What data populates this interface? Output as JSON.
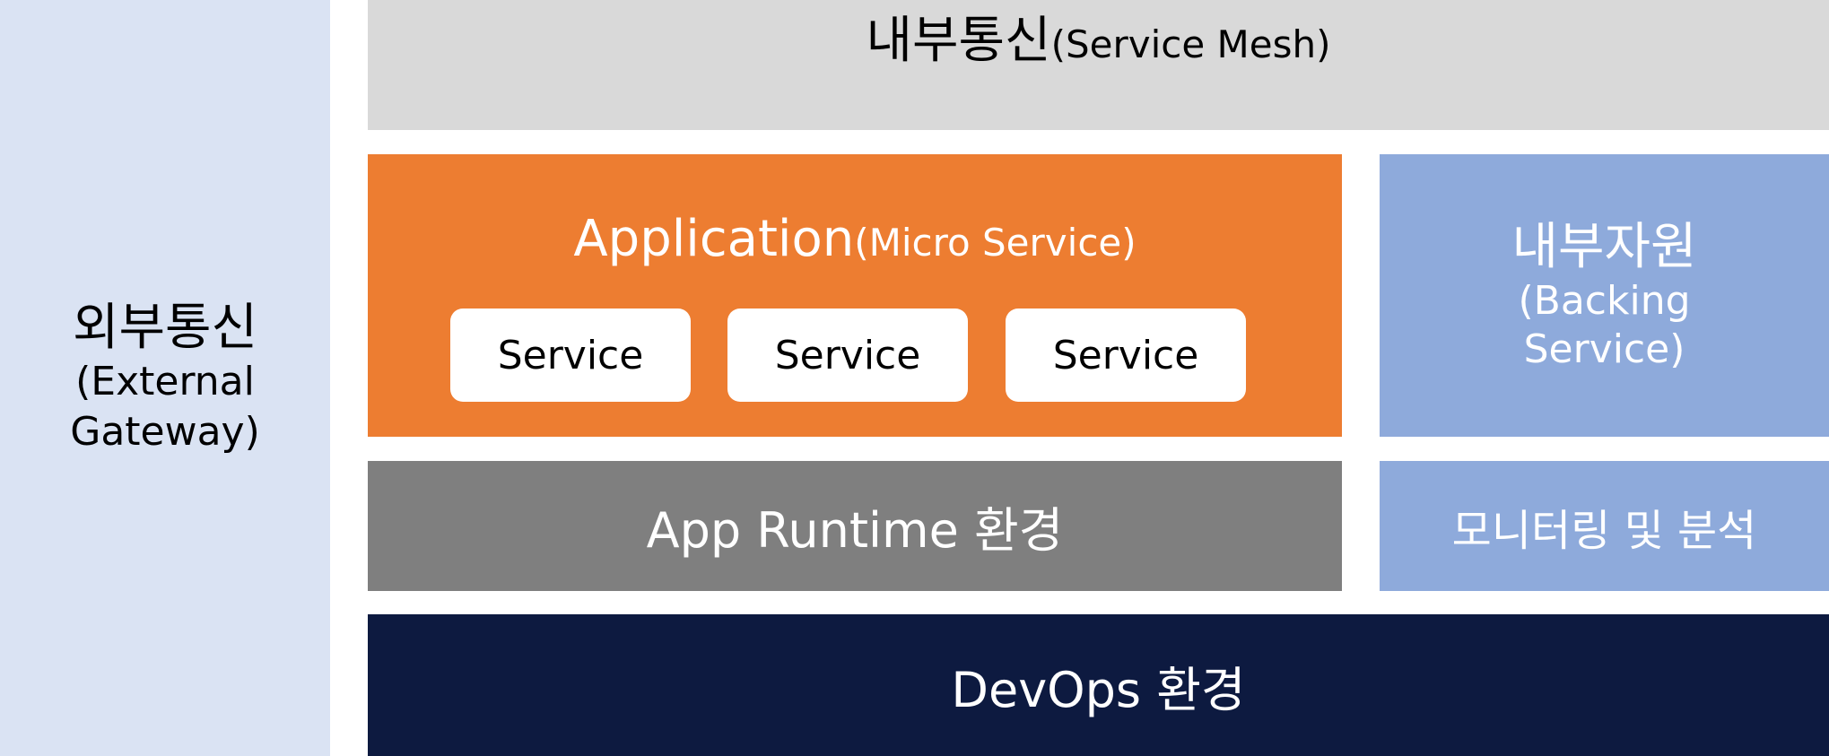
{
  "external_gateway": {
    "label": "외부통신",
    "sub_line1": "(External",
    "sub_line2": "Gateway)",
    "color": "#dae3f3"
  },
  "service_mesh": {
    "label": "내부통신",
    "sub": "(Service Mesh)",
    "color": "#d9d9d9"
  },
  "application": {
    "label": "Application",
    "sub": "(Micro Service)",
    "color": "#ed7d31",
    "services": [
      "Service",
      "Service",
      "Service"
    ]
  },
  "backing_service": {
    "label": "내부자원",
    "sub_line1": "(Backing",
    "sub_line2": "Service)",
    "color": "#8eaadb"
  },
  "app_runtime": {
    "label": "App Runtime 환경",
    "color": "#7f7f7f"
  },
  "monitoring": {
    "label": "모니터링 및 분석",
    "color": "#8eaadb"
  },
  "devops": {
    "label": "DevOps 환경",
    "color": "#0d1a40"
  }
}
